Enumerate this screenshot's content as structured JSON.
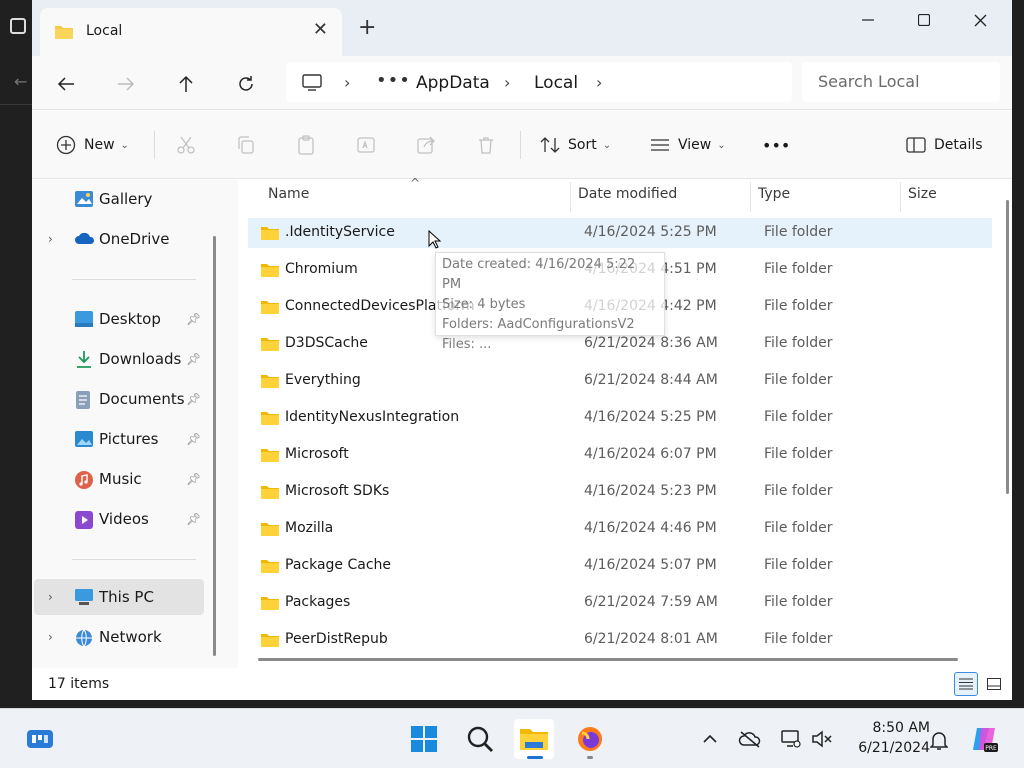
{
  "window": {
    "tab_title": "Local",
    "new_tab_symbol": "+"
  },
  "address": {
    "overflow": "•••",
    "crumbs": [
      "AppData",
      "Local"
    ]
  },
  "search": {
    "placeholder": "Search Local",
    "value": ""
  },
  "toolbar": {
    "new_label": "New",
    "sort_label": "Sort",
    "view_label": "View",
    "more_label": "•••",
    "details_label": "Details"
  },
  "sidebar": {
    "top_items": [
      {
        "label": "Gallery",
        "icon": "gallery-icon"
      },
      {
        "label": "OneDrive",
        "icon": "onedrive-icon"
      }
    ],
    "pinned": [
      {
        "label": "Desktop",
        "icon": "desktop-icon"
      },
      {
        "label": "Downloads",
        "icon": "downloads-icon"
      },
      {
        "label": "Documents",
        "icon": "documents-icon"
      },
      {
        "label": "Pictures",
        "icon": "pictures-icon"
      },
      {
        "label": "Music",
        "icon": "music-icon"
      },
      {
        "label": "Videos",
        "icon": "videos-icon"
      }
    ],
    "bottom_items": [
      {
        "label": "This PC",
        "icon": "this-pc-icon"
      },
      {
        "label": "Network",
        "icon": "network-icon"
      }
    ]
  },
  "columns": {
    "name": "Name",
    "date": "Date modified",
    "type": "Type",
    "size": "Size"
  },
  "files": [
    {
      "name": ".IdentityService",
      "date": "4/16/2024 5:25 PM",
      "type": "File folder"
    },
    {
      "name": "Chromium",
      "date": "4/16/2024 4:51 PM",
      "type": "File folder"
    },
    {
      "name": "ConnectedDevicesPlatform",
      "date": "4/16/2024 4:42 PM",
      "type": "File folder"
    },
    {
      "name": "D3DSCache",
      "date": "6/21/2024 8:36 AM",
      "type": "File folder"
    },
    {
      "name": "Everything",
      "date": "6/21/2024 8:44 AM",
      "type": "File folder"
    },
    {
      "name": "IdentityNexusIntegration",
      "date": "4/16/2024 5:25 PM",
      "type": "File folder"
    },
    {
      "name": "Microsoft",
      "date": "4/16/2024 6:07 PM",
      "type": "File folder"
    },
    {
      "name": "Microsoft SDKs",
      "date": "4/16/2024 5:23 PM",
      "type": "File folder"
    },
    {
      "name": "Mozilla",
      "date": "4/16/2024 4:46 PM",
      "type": "File folder"
    },
    {
      "name": "Package Cache",
      "date": "4/16/2024 5:07 PM",
      "type": "File folder"
    },
    {
      "name": "Packages",
      "date": "6/21/2024 7:59 AM",
      "type": "File folder"
    },
    {
      "name": "PeerDistRepub",
      "date": "6/21/2024 8:01 AM",
      "type": "File folder"
    }
  ],
  "tooltip": {
    "created": "Date created: 4/16/2024 5:22 PM",
    "size": "Size: 4 bytes",
    "folders": "Folders: AadConfigurationsV2",
    "files": "Files: ..."
  },
  "status": {
    "item_count": "17 items"
  },
  "clock": {
    "time": "8:50 AM",
    "date": "6/21/2024"
  },
  "colors": {
    "accent": "#1a73d8",
    "folder": "#f7c948",
    "hover_row": "#e5f1fb"
  }
}
